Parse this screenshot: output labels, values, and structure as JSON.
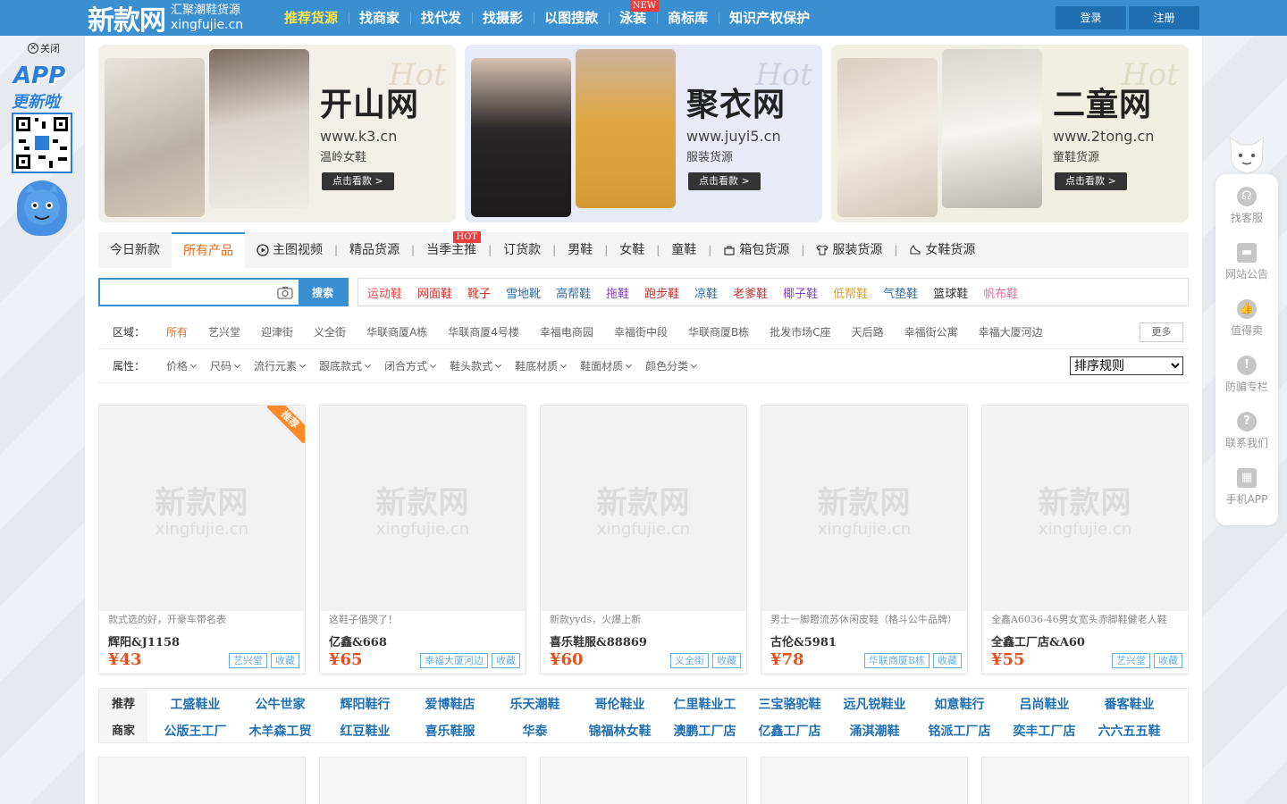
{
  "header": {
    "logo_main": "新款网",
    "logo_sub1": "汇聚潮鞋货源",
    "logo_sub2": "xingfujie.cn",
    "nav": [
      {
        "label": "推荐货源",
        "active": true
      },
      {
        "label": "找商家"
      },
      {
        "label": "找代发"
      },
      {
        "label": "找摄影"
      },
      {
        "label": "以图搜款"
      },
      {
        "label": "泳装",
        "badge": "NEW"
      },
      {
        "label": "商标库"
      },
      {
        "label": "知识产权保护"
      }
    ],
    "login": "登录",
    "register": "注册"
  },
  "banners": [
    {
      "title": "开山网",
      "hot": "Hot",
      "url": "www.k3.cn",
      "sub": "温岭女鞋",
      "button": "点击看款 >",
      "bg": "#f3efe9"
    },
    {
      "title": "聚衣网",
      "hot": "Hot",
      "url": "www.juyi5.cn",
      "sub": "服装货源",
      "button": "点击看款 >",
      "bg": "#e8ebf7"
    },
    {
      "title": "二童网",
      "hot": "Hot",
      "url": "www.2tong.cn",
      "sub": "童鞋货源",
      "button": "点击看款 >",
      "bg": "#f1efe2"
    }
  ],
  "tabs": [
    {
      "label": "今日新款"
    },
    {
      "label": "所有产品",
      "active": true
    },
    {
      "label": "主图视频",
      "icon": "play-icon"
    },
    {
      "label": "精品货源"
    },
    {
      "label": "当季主推",
      "badge": "HOT"
    },
    {
      "label": "订货款"
    },
    {
      "label": "男鞋"
    },
    {
      "label": "女鞋"
    },
    {
      "label": "童鞋"
    },
    {
      "label": "箱包货源",
      "icon": "bag-icon"
    },
    {
      "label": "服装货源",
      "icon": "shirt-icon"
    },
    {
      "label": "女鞋货源",
      "icon": "shoe-icon"
    }
  ],
  "search": {
    "value": "",
    "placeholder": "",
    "button": "搜索"
  },
  "keywords": [
    {
      "label": "运动鞋",
      "color": "#e64a4a"
    },
    {
      "label": "网面鞋",
      "color": "#c8322c"
    },
    {
      "label": "靴子",
      "color": "#d0362f"
    },
    {
      "label": "雪地靴",
      "color": "#2e6fa8"
    },
    {
      "label": "高帮鞋",
      "color": "#2e6fa8"
    },
    {
      "label": "拖鞋",
      "color": "#8a3fbf"
    },
    {
      "label": "跑步鞋",
      "color": "#c8322c"
    },
    {
      "label": "凉鞋",
      "color": "#2e6fa8"
    },
    {
      "label": "老爹鞋",
      "color": "#c8322c"
    },
    {
      "label": "椰子鞋",
      "color": "#8a3fbf"
    },
    {
      "label": "低帮鞋",
      "color": "#e0a020"
    },
    {
      "label": "气垫鞋",
      "color": "#2e6fa8"
    },
    {
      "label": "篮球鞋",
      "color": "#333333"
    },
    {
      "label": "帆布鞋",
      "color": "#e06fa0"
    }
  ],
  "region": {
    "label": "区域：",
    "options": [
      "所有",
      "艺兴堂",
      "迎津街",
      "义全街",
      "华联商厦A栋",
      "华联商厦4号楼",
      "幸福电商园",
      "幸福街中段",
      "华联商厦B栋",
      "批发市场C座",
      "天后路",
      "幸福街公寓",
      "幸福大厦河边"
    ],
    "more": "更多"
  },
  "attributes": {
    "label": "属性：",
    "options": [
      "价格",
      "尺码",
      "流行元素",
      "跟底款式",
      "闭合方式",
      "鞋头款式",
      "鞋底材质",
      "鞋面材质",
      "颜色分类"
    ],
    "sort": "排序规则"
  },
  "watermark": {
    "line1": "新款网",
    "line2": "xingfujie.cn"
  },
  "products": [
    {
      "desc": "款式选的好，开豪车带名表",
      "shop": "辉阳&J1158",
      "price": "¥43",
      "location": "艺兴堂",
      "fav": "收藏",
      "ribbon": "推荐"
    },
    {
      "desc": "这鞋子值哭了！",
      "shop": "亿鑫&668",
      "price": "¥65",
      "location": "幸福大厦河边",
      "fav": "收藏"
    },
    {
      "desc": "新款yyds，火爆上新",
      "shop": "喜乐鞋服&88869",
      "price": "¥60",
      "location": "义全街",
      "fav": "收藏"
    },
    {
      "desc": "男士一脚蹬流苏休闲皮鞋（格斗公牛品牌）",
      "shop": "古伦&5981",
      "price": "¥78",
      "location": "华联商厦B栋",
      "fav": "收藏"
    },
    {
      "desc": "全鑫A6036-46男女宽头赤脚鞋健老人鞋",
      "shop": "全鑫工厂店&A60",
      "price": "¥55",
      "location": "艺兴堂",
      "fav": "收藏"
    }
  ],
  "shops": {
    "label1": "推荐",
    "label2": "商家",
    "row1": [
      "工盛鞋业",
      "公牛世家",
      "辉阳鞋行",
      "爱博鞋店",
      "乐天潮鞋",
      "哥伦鞋业",
      "仁里鞋业工",
      "三宝骆驼鞋",
      "远凡锐鞋业",
      "如意鞋行",
      "吕尚鞋业",
      "番客鞋业"
    ],
    "row2": [
      "公版王工厂",
      "木羊森工贸",
      "红豆鞋业",
      "喜乐鞋服",
      "华泰",
      "锦福林女鞋",
      "澳鹏工厂店",
      "亿鑫工厂店",
      "涌淇潮鞋",
      "铭派工厂店",
      "奕丰工厂店",
      "六六五五鞋"
    ]
  },
  "app_ad": {
    "close": "关闭",
    "title": "APP",
    "subtitle": "更新啦"
  },
  "sidebar": [
    {
      "label": "找客服",
      "icon": "headset-icon"
    },
    {
      "label": "网站公告",
      "icon": "notice-icon"
    },
    {
      "label": "值得卖",
      "icon": "thumbs-up-icon"
    },
    {
      "label": "防骗专栏",
      "icon": "warning-icon"
    },
    {
      "label": "联系我们",
      "icon": "question-icon"
    },
    {
      "label": "手机APP",
      "icon": "qr-icon"
    }
  ],
  "colors": {
    "brand": "#3a8fd1",
    "accent": "#e66a1a",
    "price": "#e6501a"
  }
}
